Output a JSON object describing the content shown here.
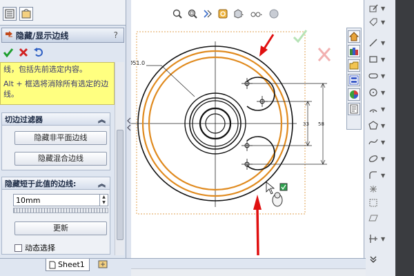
{
  "panel": {
    "title": "隐藏/显示边线",
    "help": "?",
    "message_line1": "线，包括先前选定内容。",
    "message_line2": "Alt + 框选将消除所有选定的边线。",
    "edge_filter": {
      "title": "切边过滤器",
      "btn_hide_nonplanar": "隐藏非平面边线",
      "btn_hide_blend": "隐藏混合边线"
    },
    "hide_shorter": {
      "title": "隐藏短于此值的边线:",
      "value": "10mm",
      "update": "更新",
      "dynamic_label": "动态选择"
    }
  },
  "sheet": {
    "tab_label": "Sheet1"
  },
  "drawing": {
    "diameter_label": "Ø51.0",
    "dim_33": "33",
    "dim_58": "58"
  },
  "colors": {
    "panel_bg": "#dfe6f1",
    "message_bg": "#ffff80",
    "orange_circle": "#e08a1e",
    "red_arrow": "#e01010",
    "ok_green": "#1e9e2e",
    "cancel_red": "#d12020"
  },
  "icons": {
    "ok": "check-icon",
    "cancel": "x-icon",
    "undo": "undo-icon",
    "feature_tree": "feature-tree-icon",
    "property_manager": "property-manager-icon"
  }
}
